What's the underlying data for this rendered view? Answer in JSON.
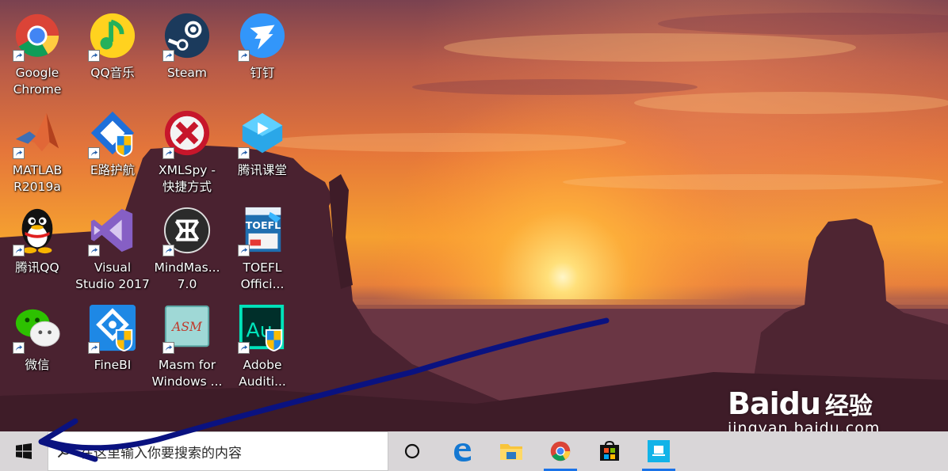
{
  "desktop": {
    "icons": [
      {
        "label": "Google\nChrome",
        "icon": "chrome-icon"
      },
      {
        "label": "QQ音乐",
        "icon": "qq-music-icon"
      },
      {
        "label": "Steam",
        "icon": "steam-icon"
      },
      {
        "label": "钉钉",
        "icon": "dingtalk-icon"
      },
      {
        "label": "MATLAB\nR2019a",
        "icon": "matlab-icon"
      },
      {
        "label": "E路护航",
        "icon": "e-escort-icon"
      },
      {
        "label": "XMLSpy -\n快捷方式",
        "icon": "xmlspy-icon"
      },
      {
        "label": "腾讯课堂",
        "icon": "tencent-classroom-icon"
      },
      {
        "label": "腾讯QQ",
        "icon": "qq-penguin-icon"
      },
      {
        "label": "Visual\nStudio 2017",
        "icon": "visual-studio-icon"
      },
      {
        "label": "MindMas...\n7.0",
        "icon": "mindmaster-icon"
      },
      {
        "label": "TOEFL\nOffici...",
        "icon": "toefl-icon"
      },
      {
        "label": "微信",
        "icon": "wechat-icon"
      },
      {
        "label": "FineBI",
        "icon": "finebi-icon"
      },
      {
        "label": "Masm for\nWindows ...",
        "icon": "masm-icon"
      },
      {
        "label": "Adobe\nAuditi...",
        "icon": "audition-icon"
      }
    ],
    "toefl_cover_text": "TOEFL",
    "masm_text": "ASM",
    "audition_text": "Au"
  },
  "taskbar": {
    "search_placeholder": "在这里输入你要搜索的内容",
    "buttons": [
      {
        "icon": "cortana-icon",
        "active": false
      },
      {
        "icon": "edge-icon",
        "active": false
      },
      {
        "icon": "file-explorer-icon",
        "active": false
      },
      {
        "icon": "chrome-icon",
        "active": true
      },
      {
        "icon": "store-icon",
        "active": false
      },
      {
        "icon": "app-icon",
        "active": true
      }
    ]
  },
  "watermark": {
    "brand": "Baidu",
    "brand_suffix": "经验",
    "url": "jingyan.baidu.com"
  },
  "colors": {
    "taskbar_bg": "#d9d6d8",
    "arrow": "#0a1280",
    "active_indicator": "#1a73e8"
  }
}
